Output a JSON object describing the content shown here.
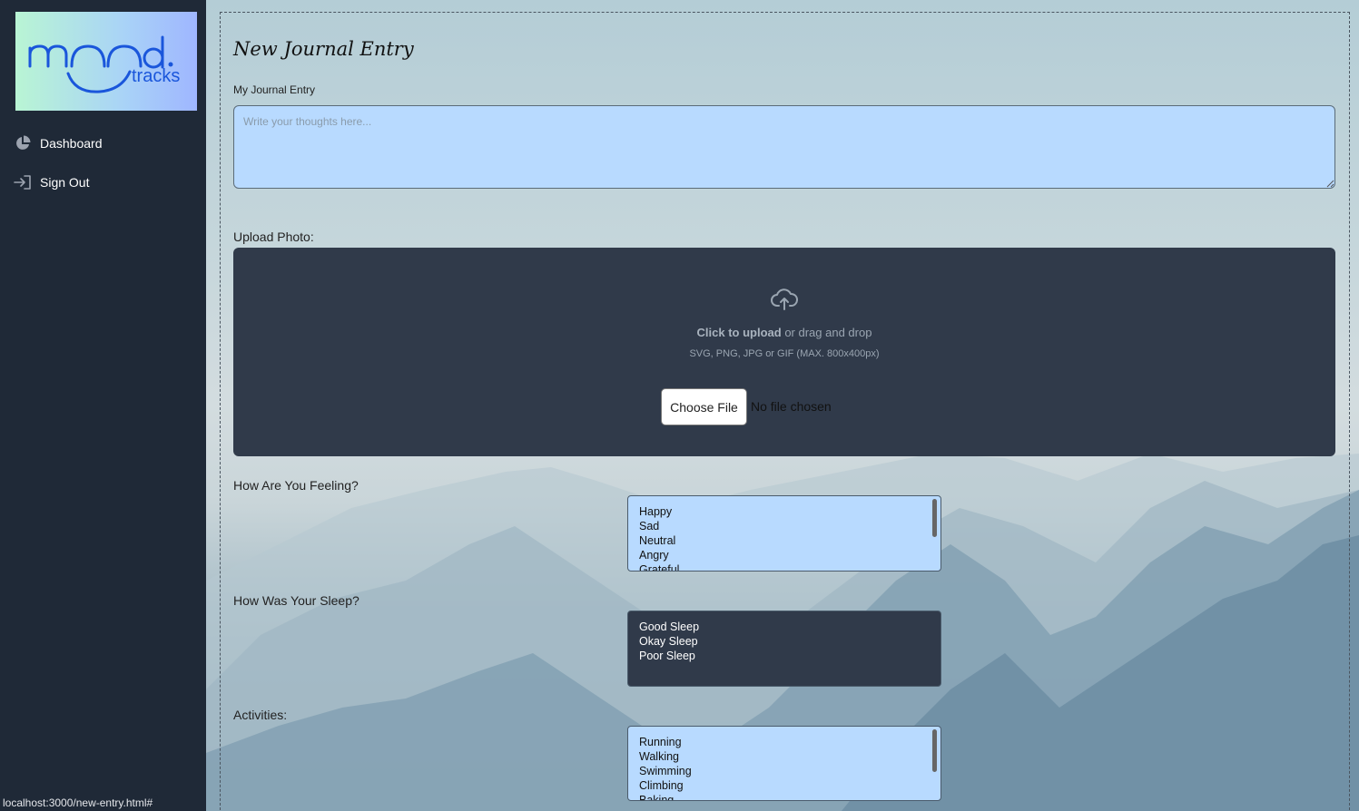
{
  "app": {
    "logo_text_main": "mood.",
    "logo_text_sub": "tracks"
  },
  "sidebar": {
    "items": [
      {
        "label": "Dashboard",
        "icon": "pie-chart-icon"
      },
      {
        "label": "Sign Out",
        "icon": "sign-out-icon"
      }
    ]
  },
  "page": {
    "title": "New Journal Entry",
    "journal_label": "My Journal Entry",
    "journal_placeholder": "Write your thoughts here...",
    "journal_value": ""
  },
  "upload": {
    "label": "Upload Photo:",
    "click_text": "Click to upload",
    "drag_text": " or drag and drop",
    "formats_text": "SVG, PNG, JPG or GIF (MAX. 800x400px)",
    "button_label": "Choose File",
    "file_status": "No file chosen",
    "icon": "cloud-upload-icon"
  },
  "feeling": {
    "label": "How Are You Feeling?",
    "options": [
      "Happy",
      "Sad",
      "Neutral",
      "Angry",
      "Grateful"
    ]
  },
  "sleep": {
    "label": "How Was Your Sleep?",
    "options": [
      "Good Sleep",
      "Okay Sleep",
      "Poor Sleep"
    ]
  },
  "activities": {
    "label": "Activities:",
    "options": [
      "Running",
      "Walking",
      "Swimming",
      "Climbing",
      "Baking"
    ]
  },
  "status_bar": {
    "url": "localhost:3000/new-entry.html#"
  },
  "colors": {
    "sidebar_bg": "#1f2937",
    "input_bg": "#b8daff",
    "dark_panel": "#303a4a",
    "logo_blue": "#1a56db"
  }
}
